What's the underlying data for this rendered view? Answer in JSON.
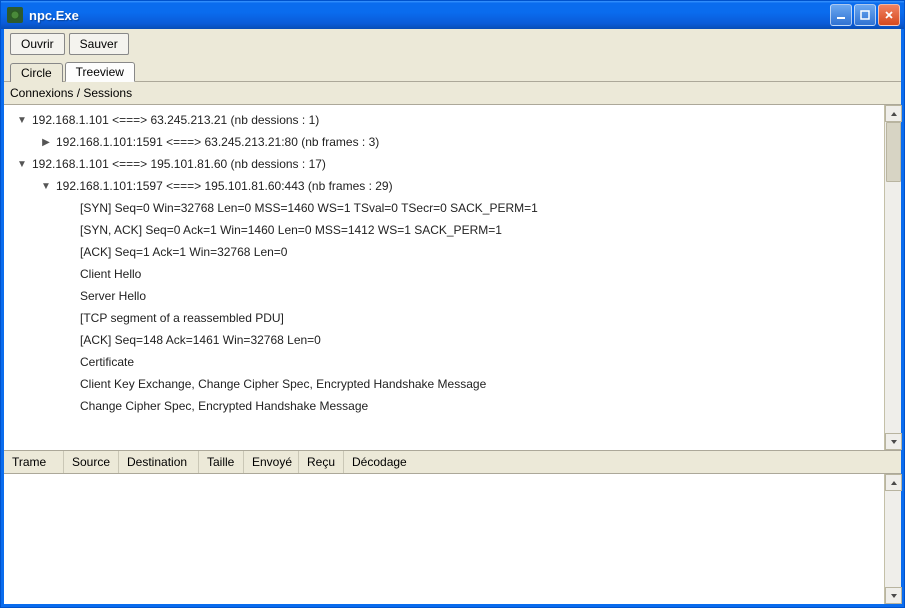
{
  "window": {
    "title": "npc.Exe"
  },
  "toolbar": {
    "open_label": "Ouvrir",
    "save_label": "Sauver"
  },
  "tabs": {
    "circle_label": "Circle",
    "treeview_label": "Treeview"
  },
  "tree_header": "Connexions / Sessions",
  "tree": [
    {
      "level": 0,
      "expanded": true,
      "text": "192.168.1.101  <===>  63.245.213.21 (nb dessions : 1)"
    },
    {
      "level": 1,
      "collapsed": true,
      "text": "192.168.1.101:1591 <===> 63.245.213.21:80 (nb frames : 3)"
    },
    {
      "level": 0,
      "expanded": true,
      "text": "192.168.1.101  <===>  195.101.81.60 (nb dessions : 17)"
    },
    {
      "level": 1,
      "expanded": true,
      "text": "192.168.1.101:1597 <===> 195.101.81.60:443 (nb frames : 29)"
    },
    {
      "level": 2,
      "text": "[SYN] Seq=0 Win=32768 Len=0 MSS=1460 WS=1 TSval=0 TSecr=0 SACK_PERM=1"
    },
    {
      "level": 2,
      "text": "[SYN, ACK] Seq=0 Ack=1 Win=1460 Len=0 MSS=1412 WS=1 SACK_PERM=1"
    },
    {
      "level": 2,
      "text": "[ACK] Seq=1 Ack=1 Win=32768 Len=0"
    },
    {
      "level": 2,
      "text": "Client Hello"
    },
    {
      "level": 2,
      "text": "Server Hello"
    },
    {
      "level": 2,
      "text": "[TCP segment of a reassembled PDU]"
    },
    {
      "level": 2,
      "text": "[ACK] Seq=148 Ack=1461 Win=32768 Len=0"
    },
    {
      "level": 2,
      "text": "Certificate"
    },
    {
      "level": 2,
      "text": "Client Key Exchange, Change Cipher Spec, Encrypted Handshake Message"
    },
    {
      "level": 2,
      "text": "Change Cipher Spec, Encrypted Handshake Message"
    }
  ],
  "columns": {
    "trame": "Trame",
    "source": "Source",
    "destination": "Destination",
    "taille": "Taille",
    "envoye": "Envoyé",
    "recu": "Reçu",
    "decodage": "Décodage"
  }
}
